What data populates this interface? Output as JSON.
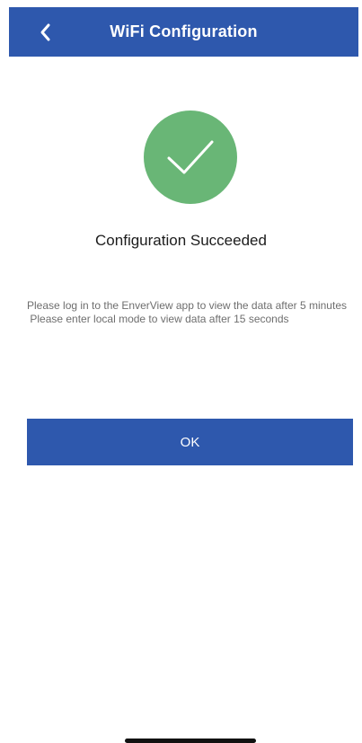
{
  "header": {
    "title": "WiFi Configuration",
    "back_icon": "chevron-left-icon"
  },
  "status": {
    "icon": "check-circle-icon",
    "title": "Configuration Succeeded",
    "accent_color": "#69b676"
  },
  "message": {
    "line1": "Please log in to the EnverView app to view the data after 5 minutes",
    "line2": " Please enter local mode to view data after 15 seconds"
  },
  "actions": {
    "ok_label": "OK"
  },
  "colors": {
    "brand": "#2e58ad",
    "success": "#69b676"
  }
}
